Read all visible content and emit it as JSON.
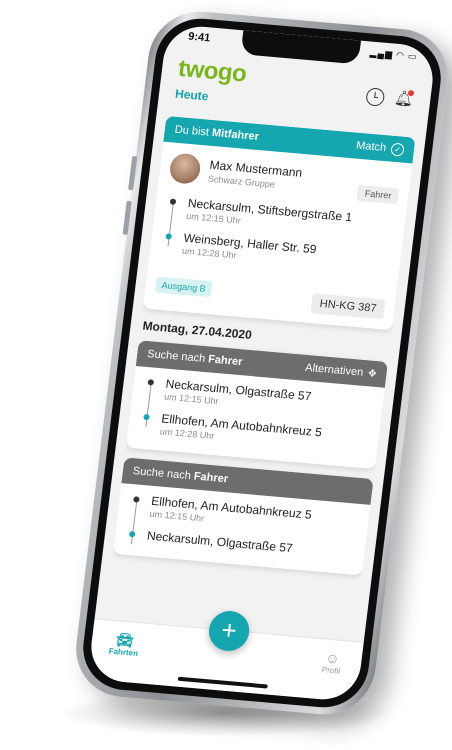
{
  "status": {
    "time": "9:41",
    "system_icons": "▂▄▆ ◠ ▭"
  },
  "header": {
    "logo": "twogo",
    "title": "Heute",
    "history_icon": "clock-icon",
    "notifications_icon": "bell-icon"
  },
  "match_card": {
    "role_prefix": "Du bist ",
    "role": "Mitfahrer",
    "status_label": "Match",
    "person": {
      "name": "Max Mustermann",
      "company": "Schwarz Gruppe",
      "role_badge": "Fahrer"
    },
    "stops": [
      {
        "address": "Neckarsulm, Stiftsbergstraße 1",
        "time": "um 12:15 Uhr"
      },
      {
        "address": "Weinsberg, Haller Str. 59",
        "time": "um 12:28 Uhr"
      }
    ],
    "exit_badge": "Ausgang B",
    "license_plate": "HN-KG 387"
  },
  "date_heading": "Montag, 27.04.2020",
  "search_cards": [
    {
      "prefix": "Suche nach ",
      "role": "Fahrer",
      "action": "Alternativen",
      "stops": [
        {
          "address": "Neckarsulm, Olgastraße 57",
          "time": "um 12:15 Uhr"
        },
        {
          "address": "Ellhofen, Am Autobahnkreuz 5",
          "time": "um 12:28 Uhr"
        }
      ]
    },
    {
      "prefix": "Suche nach ",
      "role": "Fahrer",
      "stops": [
        {
          "address": "Ellhofen, Am Autobahnkreuz 5",
          "time": "um 12:15 Uhr"
        },
        {
          "address": "Neckarsulm, Olgastraße 57",
          "time": ""
        }
      ]
    }
  ],
  "tabbar": {
    "rides_label": "Fahrten",
    "profile_label": "Profil",
    "add_label": "+"
  },
  "colors": {
    "accent": "#16a6b0",
    "brand_green": "#7ab51d",
    "muted_header": "#6d6d6d"
  }
}
